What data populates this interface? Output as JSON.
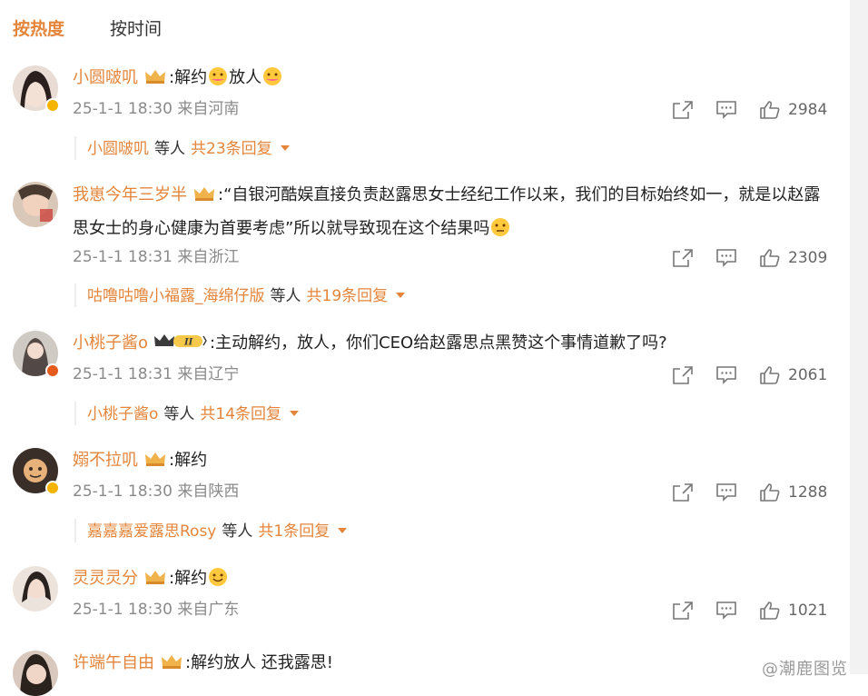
{
  "tabs": [
    {
      "label": "按热度",
      "active": true
    },
    {
      "label": "按时间",
      "active": false
    }
  ],
  "colors": {
    "accent": "#e4853b",
    "meta": "#8a8a8a",
    "verified_gold": "#f5b400",
    "verified_orange": "#e55b1c"
  },
  "icons": {
    "share": "share-icon",
    "comment": "comment-icon",
    "like": "like-icon",
    "crown": "crown-icon",
    "caret": "caret-down-icon"
  },
  "comments": [
    {
      "user": "小圆啵叽",
      "text": ":解约",
      "text2": "放人",
      "time": "25-1-1 18:30",
      "location": "来自河南",
      "likes": "2984",
      "reply": {
        "user": "小圆啵叽",
        "etc": "等人",
        "count": "共23条回复"
      }
    },
    {
      "user": "我崽今年三岁半",
      "text": ":“自银河酷娱直接负责赵露思女士经纪工作以来，我们的目标始终如一，就是以赵露思女士的身心健康为首要考虑”所以就导致现在这个结果吗",
      "time": "25-1-1 18:31",
      "location": "来自浙江",
      "likes": "2309",
      "reply": {
        "user": "咕噜咕噜小福露_海绵仔版",
        "etc": "等人",
        "count": "共19条回复"
      }
    },
    {
      "user": "小桃子酱o",
      "text": ":主动解约，放人，你们CEO给赵露思点黑赞这个事情道歉了吗?",
      "badge": "II",
      "time": "25-1-1 18:31",
      "location": "来自辽宁",
      "likes": "2061",
      "reply": {
        "user": "小桃子酱o",
        "etc": "等人",
        "count": "共14条回复"
      }
    },
    {
      "user": "嫋不拉叽",
      "text": ":解约",
      "time": "25-1-1 18:30",
      "location": "来自陕西",
      "likes": "1288",
      "reply": {
        "user": "嘉嘉嘉爱露思Rosy",
        "etc": "等人",
        "count": "共1条回复"
      }
    },
    {
      "user": "灵灵灵分",
      "text": ":解约",
      "time": "25-1-1 18:30",
      "location": "来自广东",
      "likes": "1021"
    },
    {
      "user": "许端午自由",
      "text": ":解约放人 还我露思!"
    }
  ],
  "watermark": "@潮鹿图览"
}
